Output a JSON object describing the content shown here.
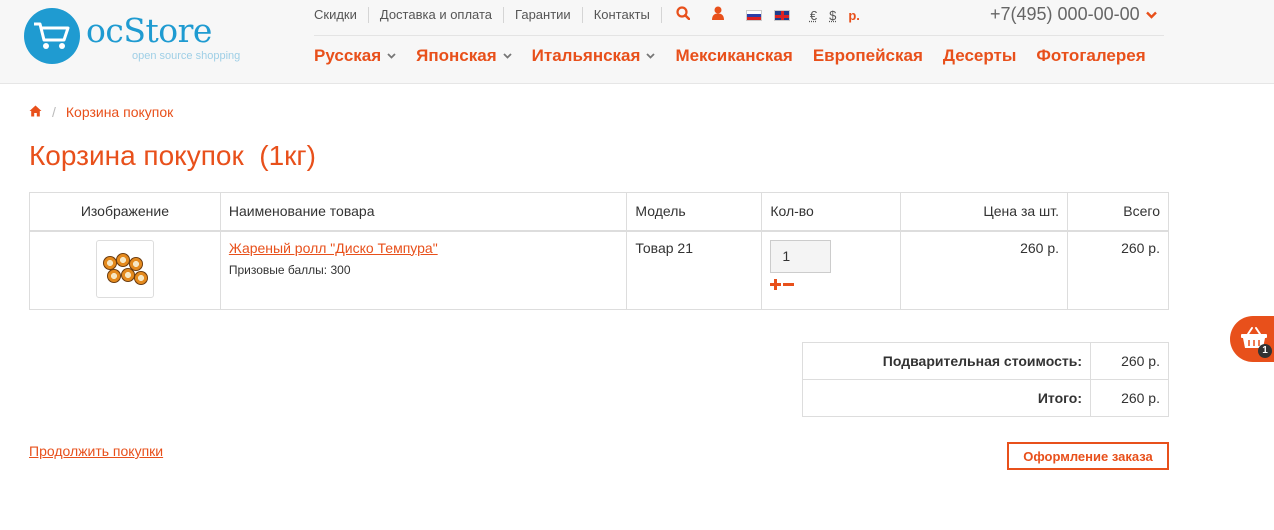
{
  "logo": {
    "text": "ocStore",
    "tagline": "open source shopping"
  },
  "header": {
    "top_links": [
      "Скидки",
      "Доставка и оплата",
      "Гарантии",
      "Контакты"
    ],
    "currencies": [
      "€",
      "$",
      "р."
    ],
    "phone": "+7(495) 000-00-00",
    "nav": [
      {
        "label": "Русская",
        "dropdown": true
      },
      {
        "label": "Японская",
        "dropdown": true
      },
      {
        "label": "Итальянская",
        "dropdown": true
      },
      {
        "label": "Мексиканская",
        "dropdown": false
      },
      {
        "label": "Европейская",
        "dropdown": false
      },
      {
        "label": "Десерты",
        "dropdown": false
      },
      {
        "label": "Фотогалерея",
        "dropdown": false
      }
    ]
  },
  "breadcrumb": {
    "current": "Корзина покупок"
  },
  "page": {
    "title": "Корзина покупок  (1кг)"
  },
  "cart": {
    "headers": {
      "image": "Изображение",
      "name": "Наименование товара",
      "model": "Модель",
      "qty": "Кол-во",
      "price": "Цена за шт.",
      "total": "Всего"
    },
    "items": [
      {
        "name": "Жареный ролл \"Диско Темпура\"",
        "points": "Призовые баллы: 300",
        "model": "Товар 21",
        "qty": "1",
        "price": "260 р.",
        "total": "260 р."
      }
    ]
  },
  "totals": [
    {
      "label": "Подварительная стоимость:",
      "value": "260 р."
    },
    {
      "label": "Итого:",
      "value": "260 р."
    }
  ],
  "actions": {
    "continue": "Продолжить покупки",
    "checkout": "Оформление заказа"
  },
  "float_cart": {
    "count": "1"
  },
  "colors": {
    "accent": "#e8501b",
    "logo_blue": "#1f9bd1"
  }
}
